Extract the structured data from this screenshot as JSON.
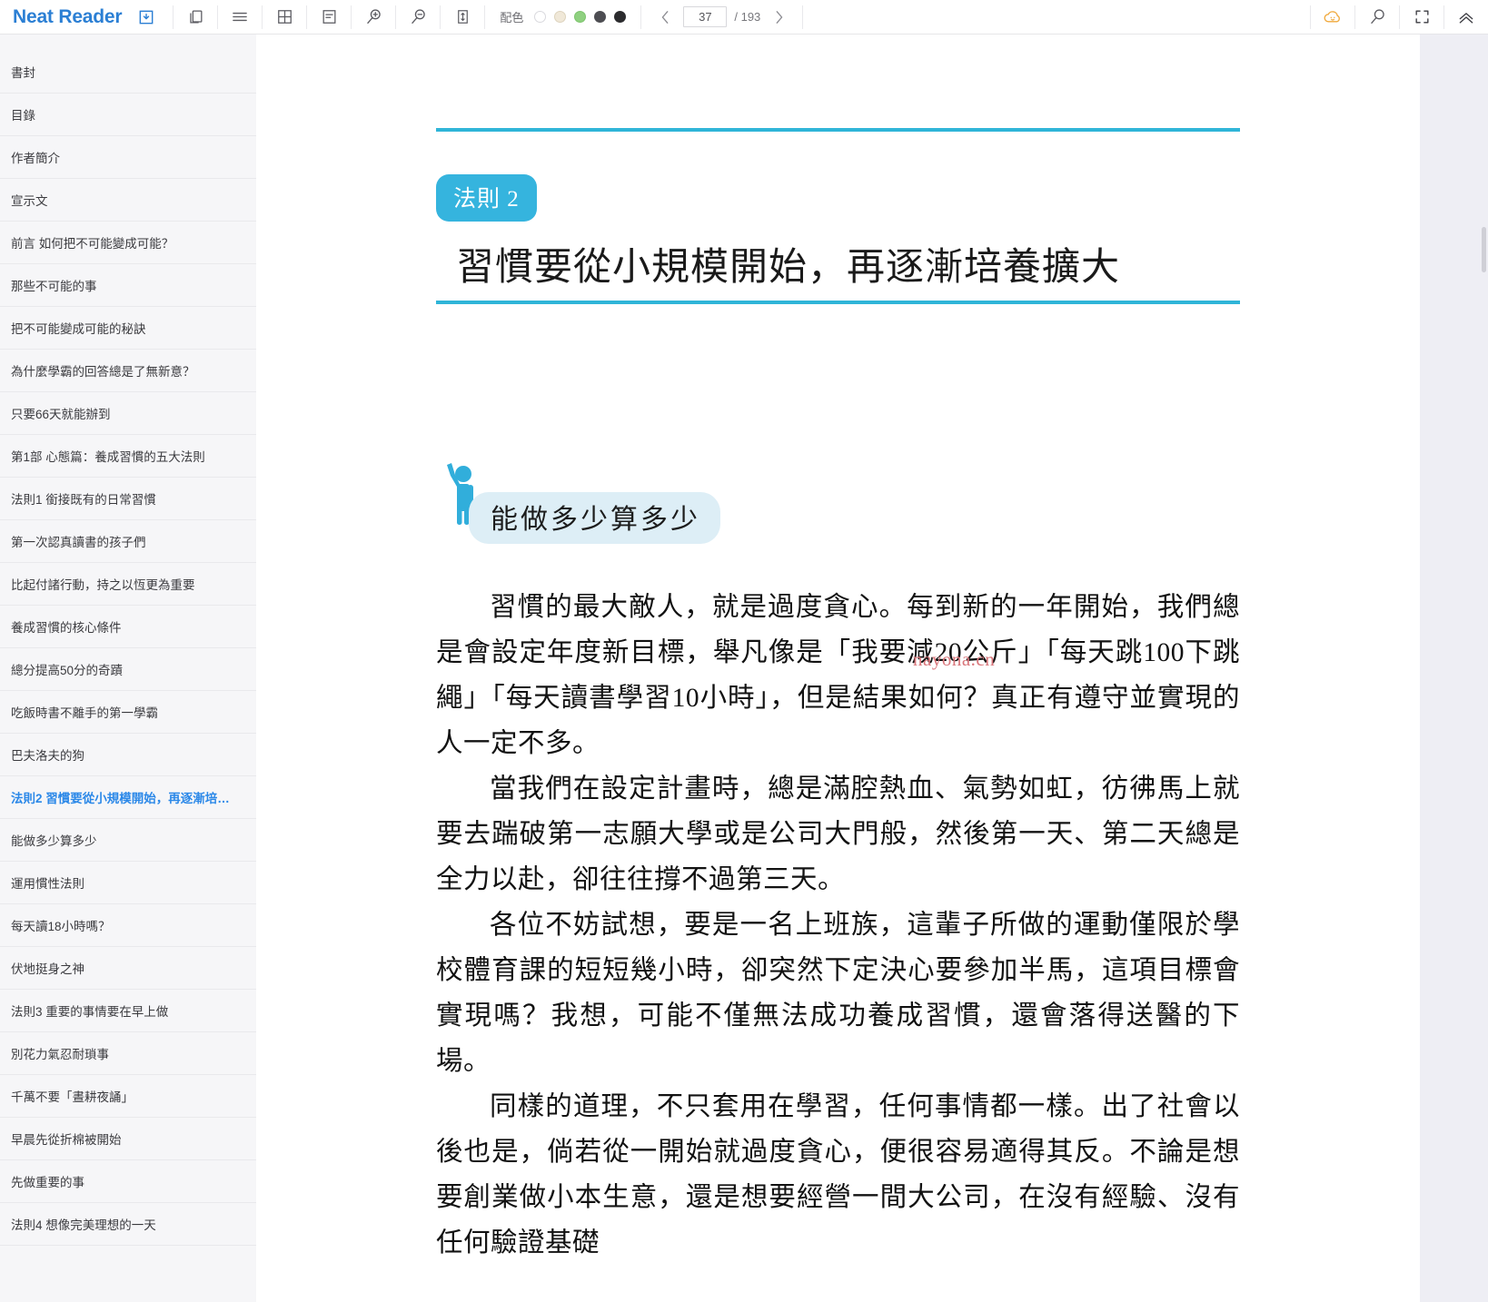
{
  "app": {
    "brand": "Neat Reader"
  },
  "toolbar": {
    "icons": [
      {
        "name": "save-book-icon",
        "label": "save-book"
      },
      {
        "name": "copy-page-icon",
        "label": "copy"
      },
      {
        "name": "toc-list-icon",
        "label": "table-of-contents"
      },
      {
        "name": "grid-layout-icon",
        "label": "grid-layout"
      },
      {
        "name": "notes-icon",
        "label": "notes"
      },
      {
        "name": "zoom-in-icon",
        "label": "zoom-in"
      },
      {
        "name": "zoom-out-icon",
        "label": "zoom-out"
      },
      {
        "name": "line-height-icon",
        "label": "line-height"
      }
    ],
    "palette_label": "配色",
    "palette_swatches": [
      {
        "name": "theme-white",
        "color": "#ffffff",
        "border": "#d8d8dc",
        "selected": false
      },
      {
        "name": "theme-sepia",
        "color": "#f0e8d8",
        "border": "#ddd3bd",
        "selected": false
      },
      {
        "name": "theme-green",
        "color": "#8fd080",
        "border": "#7cc46c",
        "selected": false
      },
      {
        "name": "theme-dark-gray",
        "color": "#4d4d52",
        "border": "#4d4d52",
        "selected": false
      },
      {
        "name": "theme-black",
        "color": "#2b2b2e",
        "border": "#2b2b2e",
        "selected": false
      }
    ],
    "pager": {
      "prev_label": "‹",
      "next_label": "›",
      "current_page": "37",
      "total_label": "/ 193",
      "placeholder": "37"
    },
    "right_icons": [
      {
        "name": "cloud-sync-icon",
        "label": "cloud-sync"
      },
      {
        "name": "search-icon",
        "label": "search"
      },
      {
        "name": "fullscreen-icon",
        "label": "fullscreen"
      },
      {
        "name": "collapse-toolbar-icon",
        "label": "collapse"
      }
    ]
  },
  "sidebar": {
    "items": [
      {
        "label": "書封",
        "active": false
      },
      {
        "label": "目錄",
        "active": false
      },
      {
        "label": "作者簡介",
        "active": false
      },
      {
        "label": "宣示文",
        "active": false
      },
      {
        "label": "前言 如何把不可能變成可能？",
        "active": false
      },
      {
        "label": "那些不可能的事",
        "active": false
      },
      {
        "label": "把不可能變成可能的秘訣",
        "active": false
      },
      {
        "label": "為什麼學霸的回答總是了無新意？",
        "active": false
      },
      {
        "label": "只要66天就能辦到",
        "active": false
      },
      {
        "label": "第1部 心態篇：養成習慣的五大法則",
        "active": false
      },
      {
        "label": "法則1 銜接既有的日常習慣",
        "active": false
      },
      {
        "label": "第一次認真讀書的孩子們",
        "active": false
      },
      {
        "label": "比起付諸行動，持之以恆更為重要",
        "active": false
      },
      {
        "label": "養成習慣的核心條件",
        "active": false
      },
      {
        "label": "總分提高50分的奇蹟",
        "active": false
      },
      {
        "label": "吃飯時書不離手的第一學霸",
        "active": false
      },
      {
        "label": "巴夫洛夫的狗",
        "active": false
      },
      {
        "label": "法則2 習慣要從小規模開始，再逐漸培…",
        "active": true
      },
      {
        "label": "能做多少算多少",
        "active": false
      },
      {
        "label": "運用慣性法則",
        "active": false
      },
      {
        "label": "每天讀18小時嗎？",
        "active": false
      },
      {
        "label": "伏地挺身之神",
        "active": false
      },
      {
        "label": "法則3 重要的事情要在早上做",
        "active": false
      },
      {
        "label": "別花力氣忍耐瑣事",
        "active": false
      },
      {
        "label": "千萬不要「晝耕夜誦」",
        "active": false
      },
      {
        "label": "早晨先從折棉被開始",
        "active": false
      },
      {
        "label": "先做重要的事",
        "active": false
      },
      {
        "label": "法則4 想像完美理想的一天",
        "active": false
      }
    ]
  },
  "reader": {
    "law_badge": "法則 2",
    "chapter_title": "習慣要從小規模開始，再逐漸培養擴大",
    "section_heading": "能做多少算多少",
    "paragraphs": [
      "習慣的最大敵人，就是過度貪心。每到新的一年開始，我們總是會設定年度新目標，舉凡像是「我要減20公斤」「每天跳100下跳繩」「每天讀書學習10小時」，但是結果如何？真正有遵守並實現的人一定不多。",
      "當我們在設定計畫時，總是滿腔熱血、氣勢如虹，彷彿馬上就要去踹破第一志願大學或是公司大門般，然後第一天、第二天總是全力以赴，卻往往撐不過第三天。",
      "各位不妨試想，要是一名上班族，這輩子所做的運動僅限於學校體育課的短短幾小時，卻突然下定決心要參加半馬，這項目標會實現嗎？我想，可能不僅無法成功養成習慣，還會落得送醫的下場。",
      "同樣的道理，不只套用在學習，任何事情都一樣。出了社會以後也是，倘若從一開始就過度貪心，便很容易適得其反。不論是想要創業做小本生意，還是想要經營一間大公司，在沒有經驗、沒有任何驗證基礎"
    ],
    "watermark": "nayona.cn",
    "accent_color": "#2fb5d8",
    "badge_color": "#35b4de",
    "pill_color": "#ddeef6"
  }
}
